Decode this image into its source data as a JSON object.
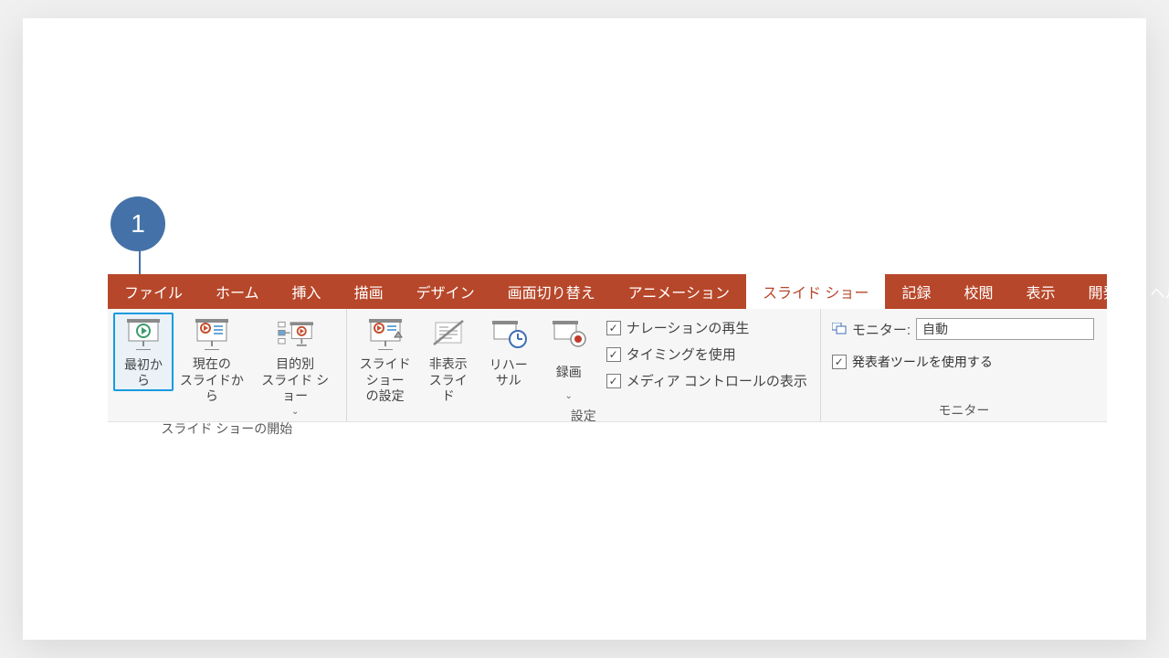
{
  "callout": {
    "number": "1"
  },
  "tabs": {
    "file": "ファイル",
    "home": "ホーム",
    "insert": "挿入",
    "draw": "描画",
    "design": "デザイン",
    "transitions": "画面切り替え",
    "animations": "アニメーション",
    "slideshow": "スライド ショー",
    "record": "記録",
    "review": "校閲",
    "view": "表示",
    "developer": "開発",
    "help": "ヘルプ"
  },
  "groups": {
    "start": {
      "label": "スライド ショーの開始",
      "from_beginning": "最初から",
      "from_current": "現在の\nスライドから",
      "custom": "目的別\nスライド ショー"
    },
    "setup": {
      "label": "設定",
      "setup_show": "スライド ショー\nの設定",
      "hide_slide": "非表示\nスライド",
      "rehearse": "リハーサル",
      "record": "録画",
      "cb_narration": "ナレーションの再生",
      "cb_timings": "タイミングを使用",
      "cb_media": "メディア コントロールの表示"
    },
    "monitors": {
      "label": "モニター",
      "monitor_label": "モニター:",
      "monitor_value": "自動",
      "cb_presenter": "発表者ツールを使用する"
    }
  }
}
